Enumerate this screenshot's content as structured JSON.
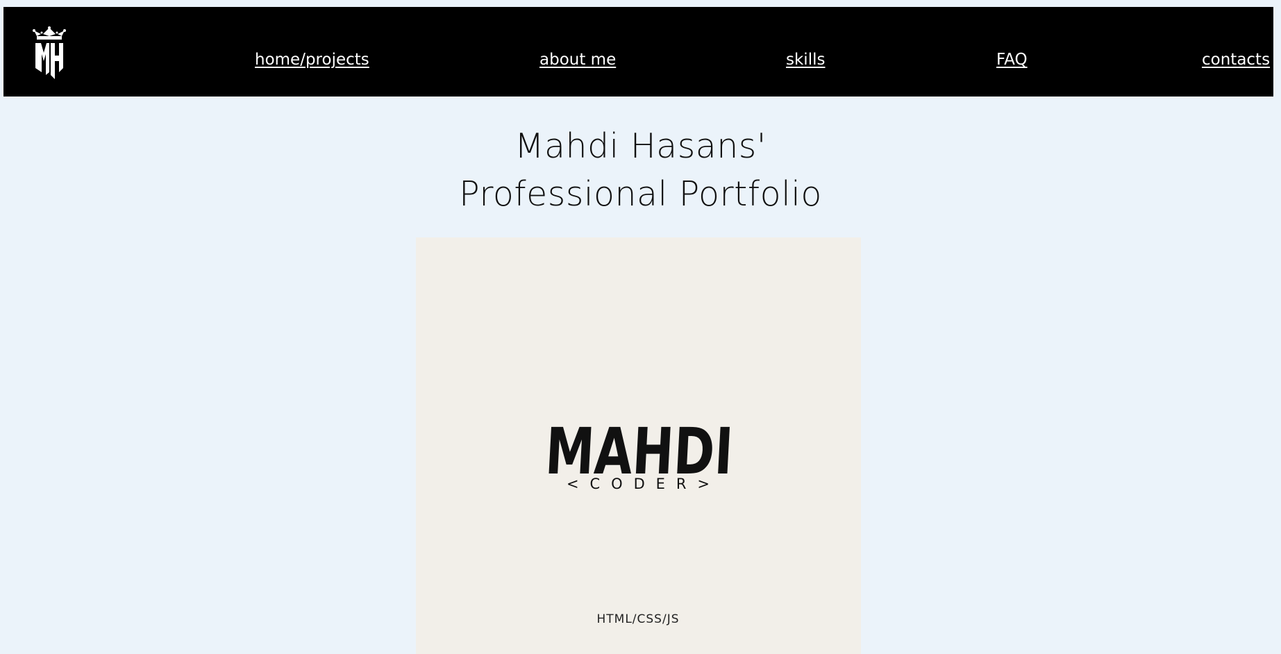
{
  "nav": {
    "logo_text": "MH",
    "links": [
      {
        "label": "home/projects"
      },
      {
        "label": "about me"
      },
      {
        "label": "skills"
      },
      {
        "label": "FAQ"
      },
      {
        "label": "contacts"
      }
    ]
  },
  "header": {
    "title_line1": "Mahdi Hasans'",
    "title_line2": "Professional Portfolio"
  },
  "hero": {
    "logo_word": "MAHDI",
    "logo_tagline": "< C O D E R >",
    "caption": "HTML/CSS/JS"
  },
  "colors": {
    "page_background": "#ebf3fa",
    "navbar_background": "#000000",
    "nav_link": "#ffffff",
    "hero_background": "#f2efe9",
    "logo_text": "#111111"
  },
  "icons": {
    "brand": "crown-monogram-icon"
  }
}
